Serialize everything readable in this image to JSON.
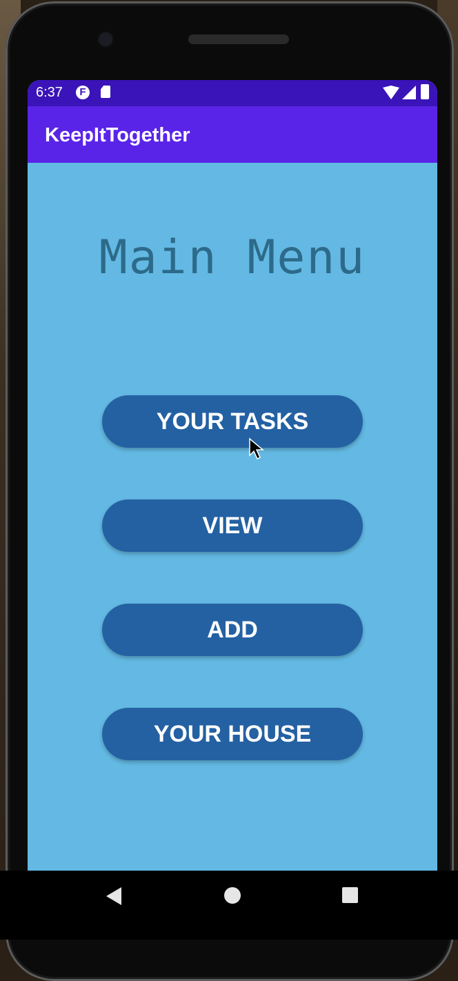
{
  "status_bar": {
    "time": "6:37",
    "left_icons": [
      "f-notification-icon",
      "sd-card-icon"
    ],
    "right_icons": [
      "wifi-icon",
      "signal-icon",
      "battery-icon"
    ]
  },
  "app_bar": {
    "title": "KeepItTogether"
  },
  "main": {
    "heading": "Main Menu",
    "buttons": [
      {
        "label": "YOUR TASKS"
      },
      {
        "label": "VIEW"
      },
      {
        "label": "ADD"
      },
      {
        "label": "YOUR HOUSE"
      }
    ]
  },
  "nav_bar": {
    "icons": [
      "back-icon",
      "home-icon",
      "recents-icon"
    ]
  },
  "colors": {
    "status_bar": "#3a14b8",
    "app_bar": "#5a24e8",
    "screen_background": "#63b9e3",
    "button": "#2461a3",
    "heading_text": "#2d6a8a"
  }
}
